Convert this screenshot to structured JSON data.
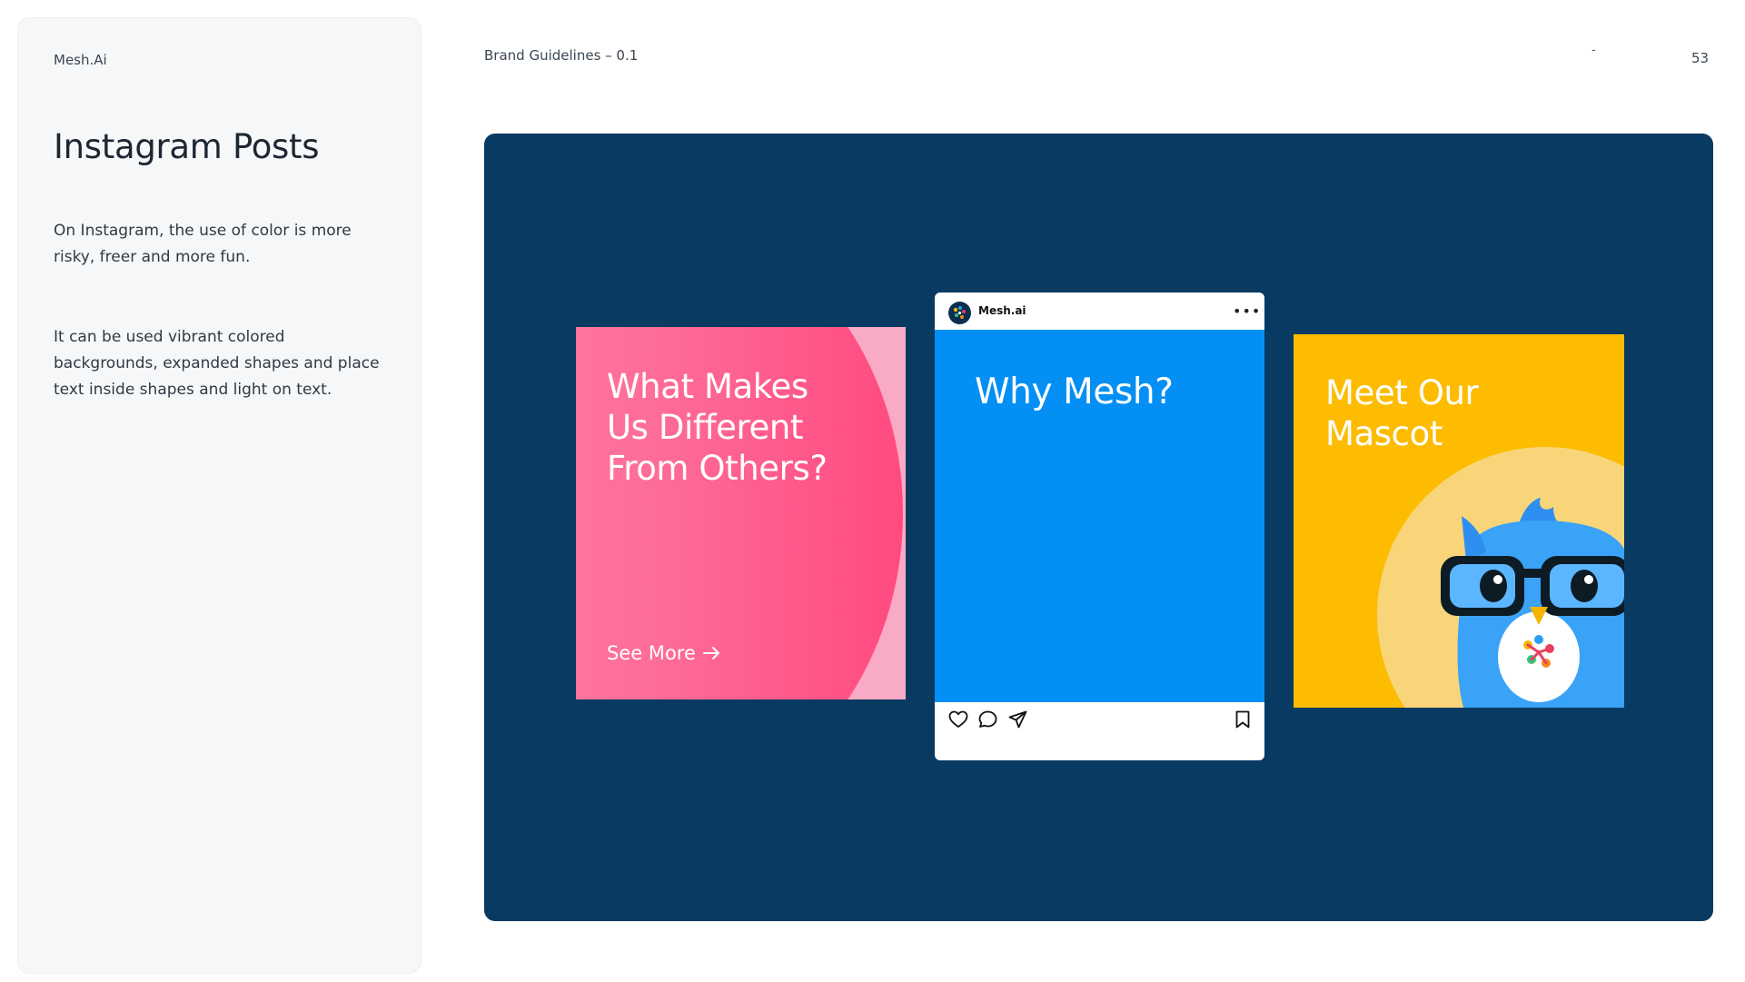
{
  "sidebar": {
    "brand": "Mesh.Ai",
    "title": "Instagram Posts",
    "paragraph1": "On Instagram, the use of color is more risky, freer and more fun.",
    "paragraph2": "It can be used vibrant colored backgrounds, expanded shapes and place text inside shapes and light on text."
  },
  "header": {
    "doc_title": "Brand Guidelines – 0.1",
    "dash": "-",
    "page_number": "53"
  },
  "posts": {
    "post1": {
      "title": "What Makes\nUs Different\nFrom Others?",
      "cta": "See More",
      "cta_icon": "arrow-right-icon"
    },
    "post2": {
      "handle": "Mesh.ai",
      "title": "Why Mesh?",
      "more_icon": "more-horizontal-icon",
      "actions": [
        "heart-icon",
        "comment-icon",
        "share-icon",
        "bookmark-icon"
      ]
    },
    "post3": {
      "title": "Meet Our\nMascot",
      "mascot": "owl-mascot"
    }
  },
  "colors": {
    "panel": "#093a62",
    "pink": "#ff4a80",
    "blue": "#038ff4",
    "yellow": "#fdbc00"
  }
}
